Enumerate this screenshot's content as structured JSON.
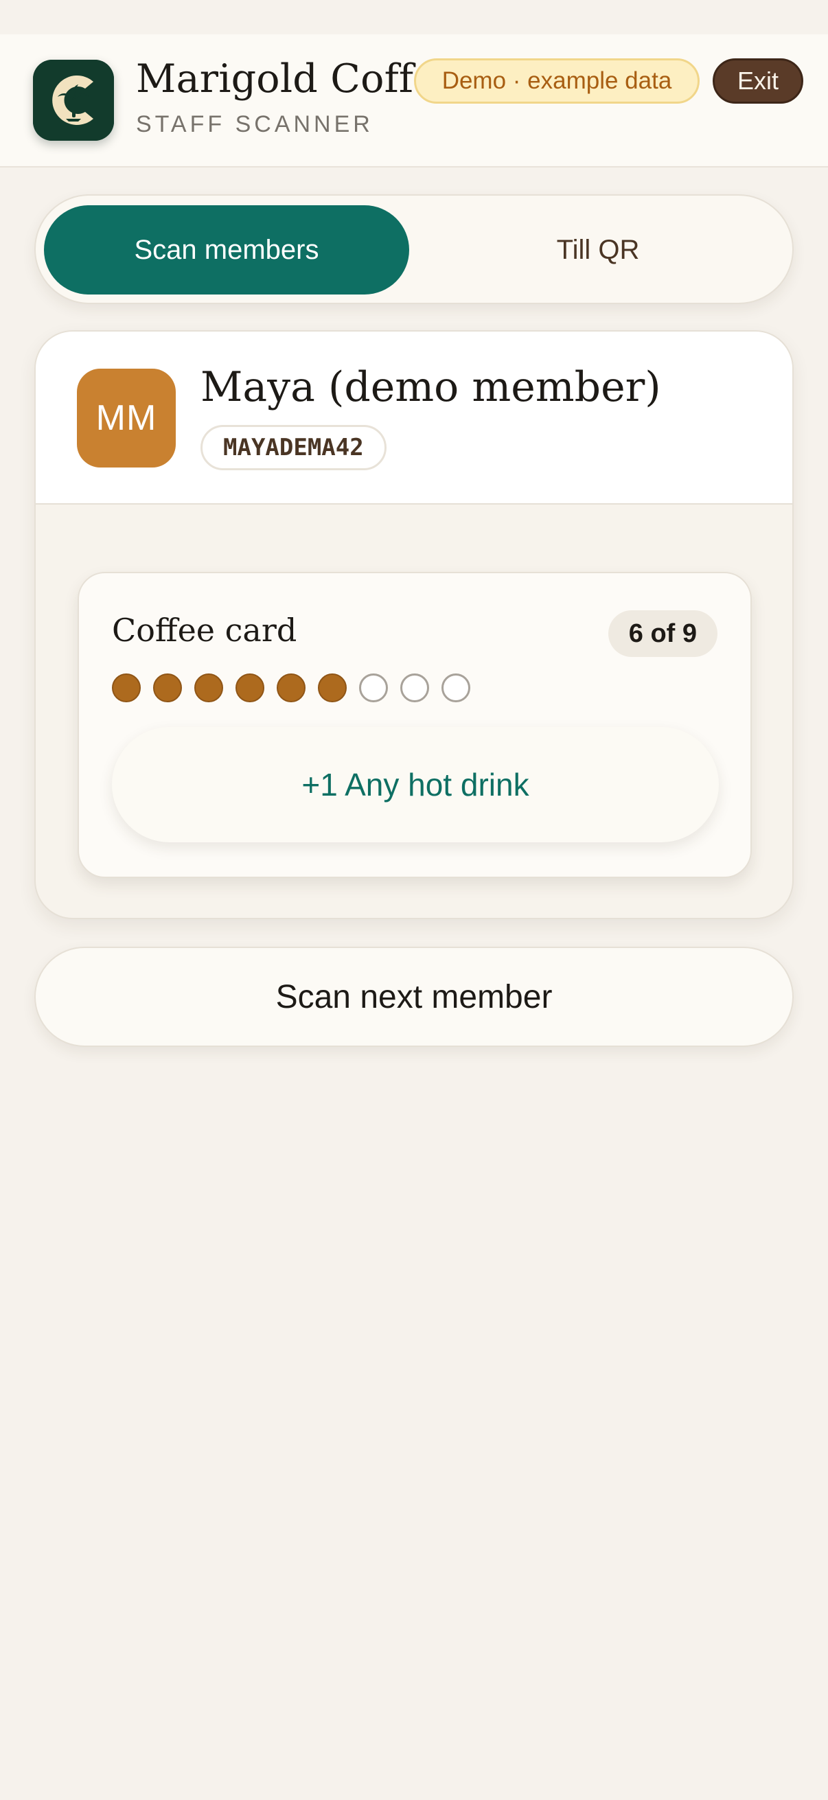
{
  "header": {
    "brand_title": "Marigold Coffee",
    "brand_subtitle": "STAFF SCANNER",
    "demo_badge": "Demo · example data",
    "exit_label": "Exit"
  },
  "tabs": [
    {
      "label": "Scan members",
      "active": true
    },
    {
      "label": "Till QR",
      "active": false
    }
  ],
  "member": {
    "initials": "MM",
    "name": "Maya (demo member)",
    "code": "MAYADEMA42"
  },
  "coffee_card": {
    "title": "Coffee card",
    "count_label": "6 of 9",
    "stamps_filled": 6,
    "stamps_total": 9,
    "reward_button": "+1 Any hot drink"
  },
  "scan_next_label": "Scan next member",
  "colors": {
    "accent_teal": "#0e6f63",
    "stamp_brown": "#ad6a1e",
    "avatar_orange": "#c98130",
    "exit_brown": "#5a3b28"
  }
}
